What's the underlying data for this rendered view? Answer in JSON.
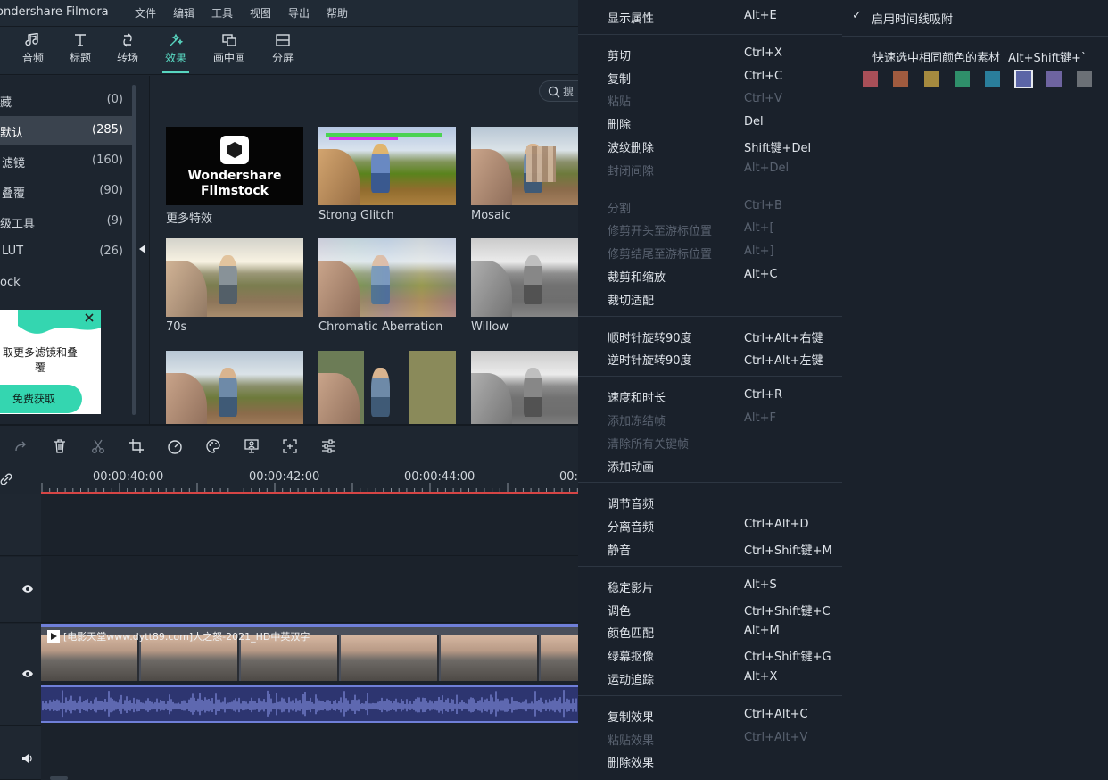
{
  "app": {
    "title": "ondershare Filmora",
    "menu": [
      "文件",
      "编辑",
      "工具",
      "视图",
      "导出",
      "帮助"
    ]
  },
  "toolbar": {
    "tools": [
      {
        "label": "音频",
        "icon": "music-note-icon"
      },
      {
        "label": "标题",
        "icon": "title-t-icon"
      },
      {
        "label": "转场",
        "icon": "transition-icon"
      },
      {
        "label": "效果",
        "icon": "effects-icon",
        "active": true
      },
      {
        "label": "画中画",
        "icon": "pip-icon"
      },
      {
        "label": "分屏",
        "icon": "split-screen-icon"
      }
    ]
  },
  "sidebar": {
    "items": [
      {
        "name": "藏",
        "count": "(0)"
      },
      {
        "name": "默认",
        "count": "(285)",
        "selected": true
      },
      {
        "name": "滤镜",
        "count": "(160)"
      },
      {
        "name": "叠覆",
        "count": "(90)"
      },
      {
        "name": "级工具",
        "count": "(9)"
      },
      {
        "name": "LUT",
        "count": "(26)"
      },
      {
        "name": "ock",
        "count": ""
      }
    ],
    "promo": {
      "text": "取更多滤镜和叠覆",
      "button": "免费获取"
    }
  },
  "effects": {
    "search_placeholder": "搜",
    "cards": [
      {
        "caption": "更多特效",
        "kind": "filmstock",
        "logo_line1": "Wondershare",
        "logo_line2": "Filmstock"
      },
      {
        "caption": "Strong Glitch",
        "kind": "glitch"
      },
      {
        "caption": "Mosaic",
        "kind": "mosaic"
      },
      {
        "caption": "70s",
        "kind": "retro"
      },
      {
        "caption": "Chromatic Aberration",
        "kind": "chroma"
      },
      {
        "caption": "Willow",
        "kind": "gray"
      },
      {
        "caption": "",
        "kind": "plain"
      },
      {
        "caption": "",
        "kind": "split"
      },
      {
        "caption": "",
        "kind": "gray"
      }
    ]
  },
  "timeline": {
    "timecodes": [
      "00:00:40:00",
      "00:00:42:00",
      "00:00:44:00",
      "00:0"
    ],
    "clip_label": "[电影天堂www.dytt89.com]人之怒-2021_HD中英双字"
  },
  "context_menu": {
    "groups": [
      [
        {
          "label": "显示属性",
          "shortcut": "Alt+E",
          "disabled": false
        }
      ],
      [
        {
          "label": "剪切",
          "shortcut": "Ctrl+X",
          "disabled": false
        },
        {
          "label": "复制",
          "shortcut": "Ctrl+C",
          "disabled": false
        },
        {
          "label": "粘贴",
          "shortcut": "Ctrl+V",
          "disabled": true
        },
        {
          "label": "删除",
          "shortcut": "Del",
          "disabled": false
        },
        {
          "label": "波纹删除",
          "shortcut": "Shift键+Del",
          "disabled": false
        },
        {
          "label": "封闭间隙",
          "shortcut": "Alt+Del",
          "disabled": true
        }
      ],
      [
        {
          "label": "分割",
          "shortcut": "Ctrl+B",
          "disabled": true
        },
        {
          "label": "修剪开头至游标位置",
          "shortcut": "Alt+[",
          "disabled": true
        },
        {
          "label": "修剪结尾至游标位置",
          "shortcut": "Alt+]",
          "disabled": true
        },
        {
          "label": "裁剪和缩放",
          "shortcut": "Alt+C",
          "disabled": false
        },
        {
          "label": "裁切适配",
          "shortcut": "",
          "disabled": false
        }
      ],
      [
        {
          "label": "顺时针旋转90度",
          "shortcut": "Ctrl+Alt+右键",
          "disabled": false
        },
        {
          "label": "逆时针旋转90度",
          "shortcut": "Ctrl+Alt+左键",
          "disabled": false
        }
      ],
      [
        {
          "label": "速度和时长",
          "shortcut": "Ctrl+R",
          "disabled": false
        },
        {
          "label": "添加冻结帧",
          "shortcut": "Alt+F",
          "disabled": true
        },
        {
          "label": "清除所有关键帧",
          "shortcut": "",
          "disabled": true
        },
        {
          "label": "添加动画",
          "shortcut": "",
          "disabled": false
        }
      ],
      [
        {
          "label": "调节音频",
          "shortcut": "",
          "disabled": false
        },
        {
          "label": "分离音频",
          "shortcut": "Ctrl+Alt+D",
          "disabled": false
        },
        {
          "label": "静音",
          "shortcut": "Ctrl+Shift键+M",
          "disabled": false
        }
      ],
      [
        {
          "label": "稳定影片",
          "shortcut": "Alt+S",
          "disabled": false
        },
        {
          "label": "调色",
          "shortcut": "Ctrl+Shift键+C",
          "disabled": false
        },
        {
          "label": "颜色匹配",
          "shortcut": "Alt+M",
          "disabled": false
        },
        {
          "label": "绿幕抠像",
          "shortcut": "Ctrl+Shift键+G",
          "disabled": false
        },
        {
          "label": "运动追踪",
          "shortcut": "Alt+X",
          "disabled": false
        }
      ],
      [
        {
          "label": "复制效果",
          "shortcut": "Ctrl+Alt+C",
          "disabled": false
        },
        {
          "label": "粘贴效果",
          "shortcut": "Ctrl+Alt+V",
          "disabled": true
        },
        {
          "label": "删除效果",
          "shortcut": "",
          "disabled": false
        }
      ]
    ]
  },
  "submenu": {
    "snap_label": "启用时间线吸附",
    "snap_checked": true,
    "select_same_color_label": "快速选中相同颜色的素材",
    "select_same_color_shortcut": "Alt+Shift键+`",
    "swatches": [
      "#a84f58",
      "#a05b3f",
      "#a58a3f",
      "#2f8f6a",
      "#2a7e9b",
      "#5b65a6",
      "#6e64a0",
      "#6b7076"
    ],
    "selected_swatch": 5
  }
}
